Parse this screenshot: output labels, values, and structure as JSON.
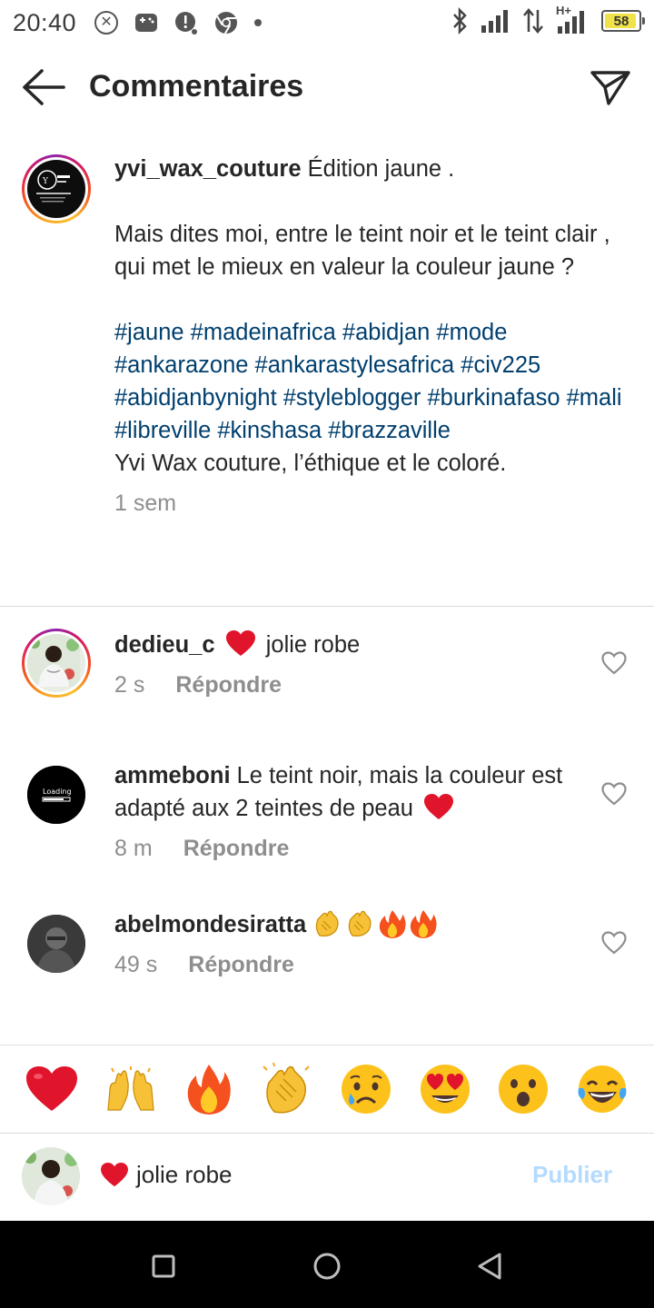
{
  "status_bar": {
    "time": "20:40",
    "battery_level": "58",
    "network_label": "H+",
    "colors": {
      "battery_fill": "#f1e24a"
    },
    "icons": [
      "close-circle-icon",
      "game-controller-icon",
      "alert-chat-icon",
      "chrome-icon",
      "dot-icon",
      "bluetooth-icon",
      "signal-icon",
      "data-arrows-icon",
      "battery-icon"
    ]
  },
  "header": {
    "title": "Commentaires",
    "back_icon": "arrow-left-icon",
    "share_icon": "paper-plane-icon"
  },
  "caption": {
    "username": "yvi_wax_couture",
    "first_line": "Édition jaune .",
    "body": "Mais dites moi, entre le teint noir et le teint clair , qui met le mieux en valeur la couleur jaune ?",
    "hashtags": "#jaune #madeinafrica #abidjan #mode #ankarazone #ankarastylesafrica #civ225 #abidjanbynight #styleblogger #burkinafaso #mali #libreville #kinshasa #brazzaville",
    "closing": "Yvi Wax couture, l’éthique et le coloré.",
    "time": "1 sem"
  },
  "comments": [
    {
      "username": "dedieu_c",
      "text": "jolie robe",
      "prefix_emoji": "heart-emoji",
      "time": "2 s",
      "reply_label": "Répondre"
    },
    {
      "username": "ammeboni",
      "text": "Le teint noir, mais la couleur est adapté aux 2 teintes de peau",
      "suffix_emoji": "heart-emoji",
      "time": "8 m",
      "reply_label": "Répondre",
      "avatar_text": "Loading"
    },
    {
      "username": "abelmondesiratta",
      "text": "",
      "emojis": [
        "clapping-hands-emoji",
        "clapping-hands-emoji",
        "fire-emoji",
        "fire-emoji"
      ],
      "time": "49 s",
      "reply_label": "Répondre"
    }
  ],
  "emoji_bar": [
    "red-heart-emoji",
    "raising-hands-emoji",
    "fire-emoji",
    "clapping-hands-emoji",
    "crying-face-emoji",
    "heart-eyes-emoji",
    "surprised-face-emoji",
    "tears-of-joy-emoji"
  ],
  "composer": {
    "text": "jolie robe",
    "publish_label": "Publier",
    "colors": {
      "publish": "#b3dbff"
    }
  },
  "colors": {
    "hashtag": "#003f6e",
    "muted": "#8e8e8e",
    "heart": "#e0142a"
  },
  "nav_bar": [
    "recents-square-icon",
    "home-circle-icon",
    "back-triangle-icon"
  ]
}
